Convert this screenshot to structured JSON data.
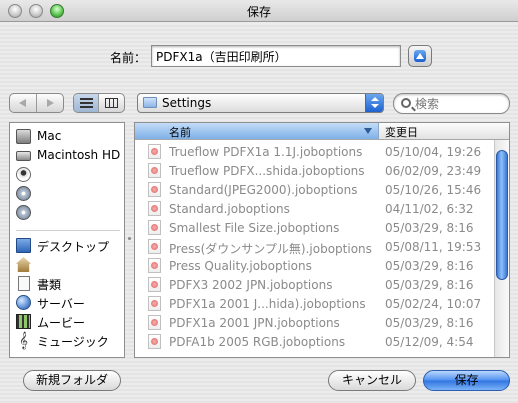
{
  "window": {
    "title": "保存"
  },
  "save_as": {
    "label": "名前：",
    "value": "PDFX1a（吉田印刷所）"
  },
  "toolbar": {
    "location": "Settings",
    "search_placeholder": "検索"
  },
  "sidebar": {
    "devices": [
      {
        "label": "Mac",
        "icon": "computer-icon"
      },
      {
        "label": "Macintosh HD",
        "icon": "hard-drive-icon"
      },
      {
        "label": "",
        "icon": "network-user-icon"
      },
      {
        "label": "",
        "icon": "disc-icon"
      },
      {
        "label": "",
        "icon": "disc-icon"
      }
    ],
    "places": [
      {
        "label": "デスクトップ",
        "icon": "desktop-icon"
      },
      {
        "label": "",
        "icon": "home-icon"
      },
      {
        "label": "書類",
        "icon": "documents-icon"
      },
      {
        "label": "サーバー",
        "icon": "server-icon"
      },
      {
        "label": "ムービー",
        "icon": "movies-icon"
      },
      {
        "label": "ミュージック",
        "icon": "music-icon"
      }
    ]
  },
  "file_list": {
    "columns": {
      "name": "名前",
      "date": "変更日"
    },
    "rows": [
      {
        "name": "Trueflow PDFX1a 1.1J.joboptions",
        "date": "05/10/04, 19:26"
      },
      {
        "name": "Trueflow PDFX...shida.joboptions",
        "date": "06/02/09, 23:49"
      },
      {
        "name": "Standard(JPEG2000).joboptions",
        "date": "05/10/26, 15:46"
      },
      {
        "name": "Standard.joboptions",
        "date": "04/11/02, 6:32"
      },
      {
        "name": "Smallest File Size.joboptions",
        "date": "05/03/29, 8:16"
      },
      {
        "name": "Press(ダウンサンプル無).joboptions",
        "date": "05/08/11, 19:53"
      },
      {
        "name": "Press Quality.joboptions",
        "date": "05/03/29, 8:16"
      },
      {
        "name": "PDFX3 2002 JPN.joboptions",
        "date": "05/03/29, 8:16"
      },
      {
        "name": "PDFX1a 2001 J...hida).joboptions",
        "date": "05/02/24, 10:07"
      },
      {
        "name": "PDFX1a 2001 JPN.joboptions",
        "date": "05/03/29, 8:16"
      },
      {
        "name": "PDFA1b 2005 RGB.joboptions",
        "date": "05/12/09, 4:54"
      }
    ]
  },
  "buttons": {
    "new_folder": "新規フォルダ",
    "cancel": "キャンセル",
    "save": "保存"
  }
}
